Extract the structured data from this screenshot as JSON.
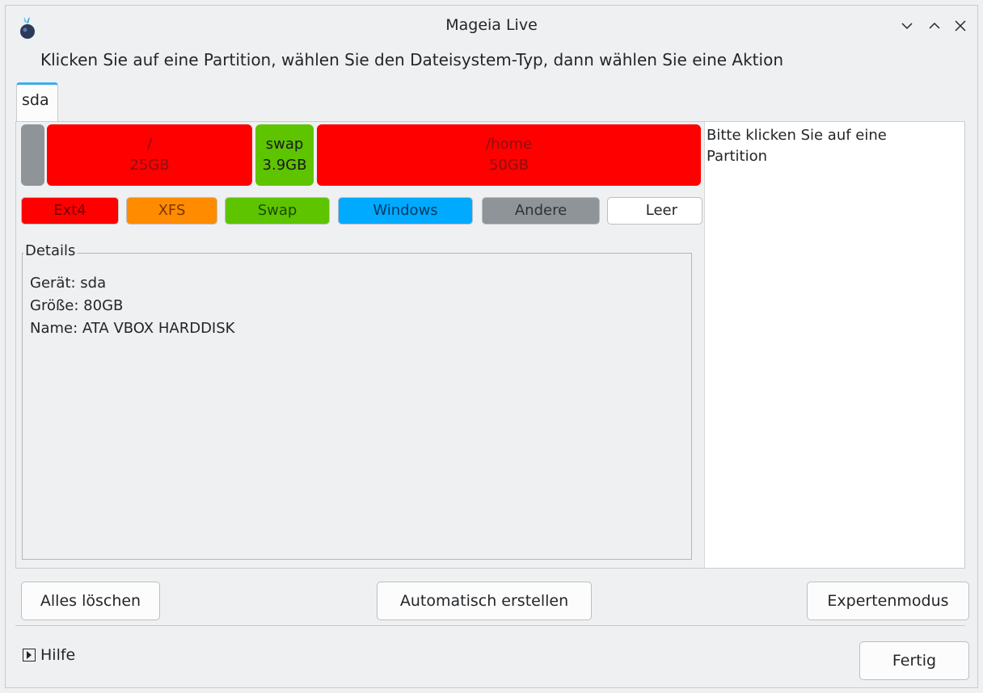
{
  "window": {
    "title": "Mageia Live"
  },
  "instruction": "Klicken Sie auf eine Partition, wählen Sie den Dateisystem-Typ, dann wählen Sie eine Aktion",
  "tabs": [
    {
      "label": "sda"
    }
  ],
  "partitions": [
    {
      "mount": "",
      "size": "",
      "color": "#8f9499"
    },
    {
      "mount": "/",
      "size": "25GB",
      "color": "#ff0000"
    },
    {
      "mount": "swap",
      "size": "3.9GB",
      "color": "#5ec400"
    },
    {
      "mount": "/home",
      "size": "50GB",
      "color": "#ff0000"
    }
  ],
  "legend": [
    {
      "label": "Ext4",
      "color": "#ff0000"
    },
    {
      "label": "XFS",
      "color": "#ff8c00"
    },
    {
      "label": "Swap",
      "color": "#5ec400"
    },
    {
      "label": "Windows",
      "color": "#00aaff"
    },
    {
      "label": "Andere",
      "color": "#8f9499"
    },
    {
      "label": "Leer",
      "color": "#ffffff"
    }
  ],
  "info_pane": {
    "text": "Bitte klicken Sie auf eine Partition"
  },
  "details": {
    "title": "Details",
    "lines": [
      "Gerät: sda",
      "Größe: 80GB",
      "Name: ATA VBOX HARDDISK"
    ]
  },
  "buttons": {
    "clear_all": "Alles löschen",
    "auto_allocate": "Automatisch erstellen",
    "expert_mode": "Expertenmodus",
    "done": "Fertig"
  },
  "help": {
    "label": "Hilfe"
  }
}
